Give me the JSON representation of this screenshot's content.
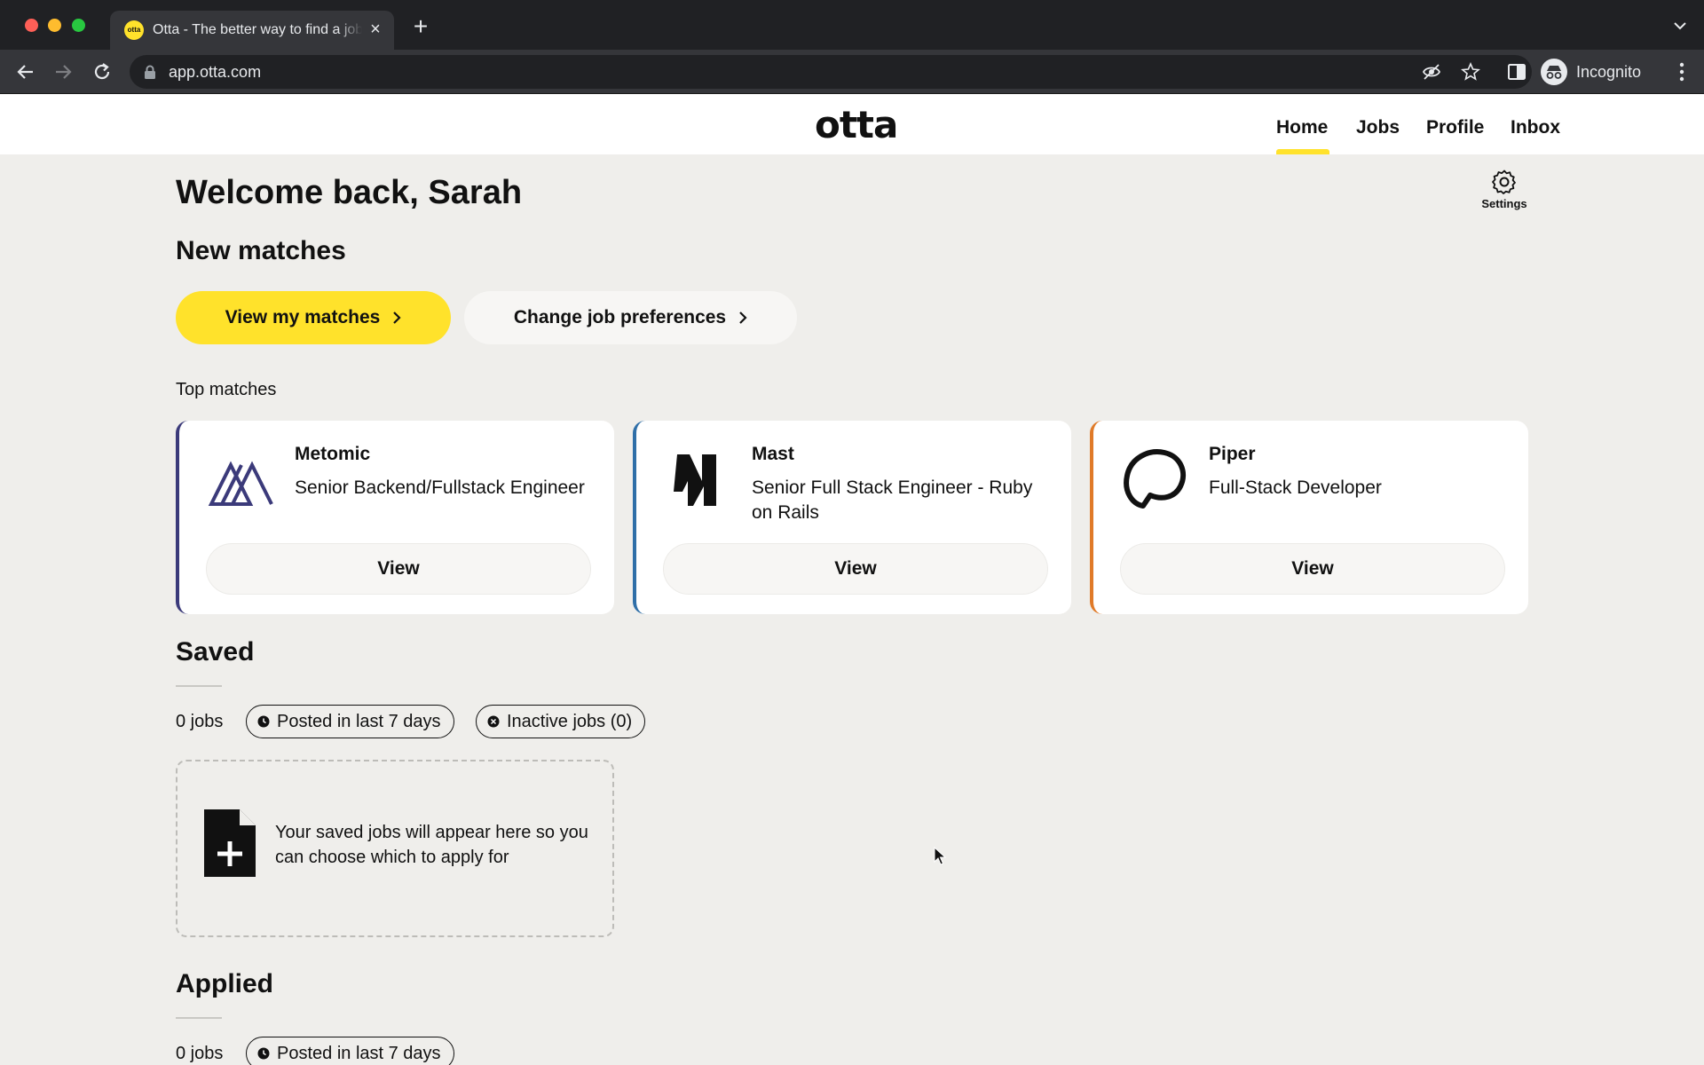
{
  "browser": {
    "tab_title": "Otta - The better way to find a job",
    "tab_favicon_text": "otta",
    "new_tab": "+",
    "close_tab": "×",
    "url": "app.otta.com",
    "profile_label": "Incognito",
    "icons": [
      "back-icon",
      "forward-icon",
      "reload-icon",
      "lock-icon",
      "eye-off-icon",
      "star-icon",
      "side-panel-icon",
      "incognito-icon",
      "kebab-menu-icon",
      "tab-search-icon"
    ]
  },
  "header": {
    "logo": "otta",
    "nav": [
      {
        "label": "Home",
        "active": true
      },
      {
        "label": "Jobs",
        "active": false
      },
      {
        "label": "Profile",
        "active": false
      },
      {
        "label": "Inbox",
        "active": false
      }
    ],
    "accent_color": "#ffe22b"
  },
  "main": {
    "welcome": "Welcome back, Sarah",
    "settings_label": "Settings",
    "new_matches": {
      "heading": "New matches",
      "primary_button": "View my matches",
      "secondary_button": "Change job preferences"
    },
    "top_matches": {
      "label": "Top matches",
      "cards": [
        {
          "company": "Metomic",
          "role": "Senior Backend/Fullstack Engineer",
          "button": "View",
          "accent": "#3b3a7a",
          "logo_icon": "metomic-logo"
        },
        {
          "company": "Mast",
          "role": "Senior Full Stack Engineer - Ruby on Rails",
          "button": "View",
          "accent": "#2f6fa8",
          "logo_icon": "mast-logo"
        },
        {
          "company": "Piper",
          "role": "Full-Stack Developer",
          "button": "View",
          "accent": "#e07a28",
          "logo_icon": "piper-logo"
        }
      ]
    },
    "saved": {
      "heading": "Saved",
      "count": "0 jobs",
      "filters": [
        "Posted in last 7 days",
        "Inactive jobs (0)"
      ],
      "empty_text": "Your saved jobs will appear here so you can choose which to apply for"
    },
    "applied": {
      "heading": "Applied",
      "count": "0 jobs",
      "filters": [
        "Posted in last 7 days"
      ]
    }
  }
}
